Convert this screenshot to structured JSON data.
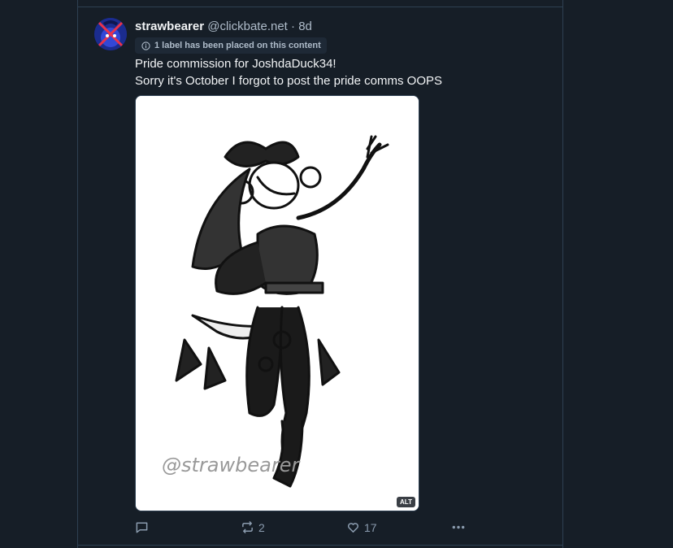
{
  "post": {
    "author": {
      "display_name": "strawbearer",
      "handle": "@clickbate.net",
      "separator": "·",
      "age": "8d"
    },
    "label_notice": "1 label has been placed on this content",
    "text_lines": [
      "Pride commission for JoshdaDuck34!",
      "Sorry it's October I forgot to post the pride comms OOPS"
    ],
    "image": {
      "alt_badge": "ALT",
      "watermark": "@strawbearer"
    },
    "actions": {
      "reply_icon": "speech-bubble-icon",
      "repost_icon": "repost-arrows-icon",
      "repost_count": "2",
      "like_icon": "heart-icon",
      "like_count": "17",
      "more_icon": "ellipsis-icon"
    }
  },
  "colors": {
    "background": "#161e27",
    "border": "#2e4052",
    "text_primary": "#f1f3f5",
    "text_secondary": "#aebbc9",
    "icon": "#8a9bae"
  }
}
